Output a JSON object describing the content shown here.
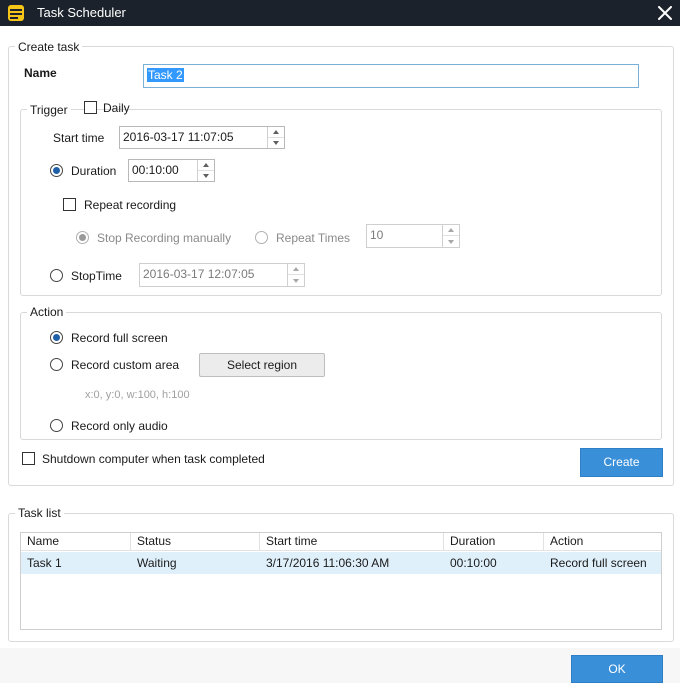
{
  "window": {
    "title": "Task Scheduler"
  },
  "create_task": {
    "legend": "Create task",
    "name_label": "Name",
    "name_value": "Task 2",
    "trigger": {
      "legend": "Trigger",
      "daily_label": "Daily",
      "daily_checked": false,
      "start_time_label": "Start time",
      "start_time_value": "2016-03-17 11:07:05",
      "duration_label": "Duration",
      "duration_value": "00:10:00",
      "duration_selected": true,
      "repeat_recording_label": "Repeat recording",
      "repeat_recording_checked": false,
      "stop_manually_label": "Stop Recording manually",
      "repeat_times_label": "Repeat Times",
      "repeat_times_value": "10",
      "stoptime_label": "StopTime",
      "stoptime_value": "2016-03-17 12:07:05"
    },
    "action": {
      "legend": "Action",
      "full_screen_label": "Record full screen",
      "custom_area_label": "Record custom area",
      "select_region_label": "Select region",
      "region_hint": "x:0, y:0, w:100, h:100",
      "only_audio_label": "Record only audio",
      "selected": "full_screen"
    },
    "shutdown_label": "Shutdown computer when task completed",
    "create_button": "Create"
  },
  "task_list": {
    "legend": "Task list",
    "columns": [
      "Name",
      "Status",
      "Start time",
      "Duration",
      "Action"
    ],
    "rows": [
      {
        "name": "Task 1",
        "status": "Waiting",
        "start_time": "3/17/2016 11:06:30 AM",
        "duration": "00:10:00",
        "action": "Record full screen"
      }
    ]
  },
  "ok_button": "OK",
  "colors": {
    "titlebar": "#1b222b",
    "accent": "#3a8fd9",
    "selected_row": "#dff0fb"
  }
}
